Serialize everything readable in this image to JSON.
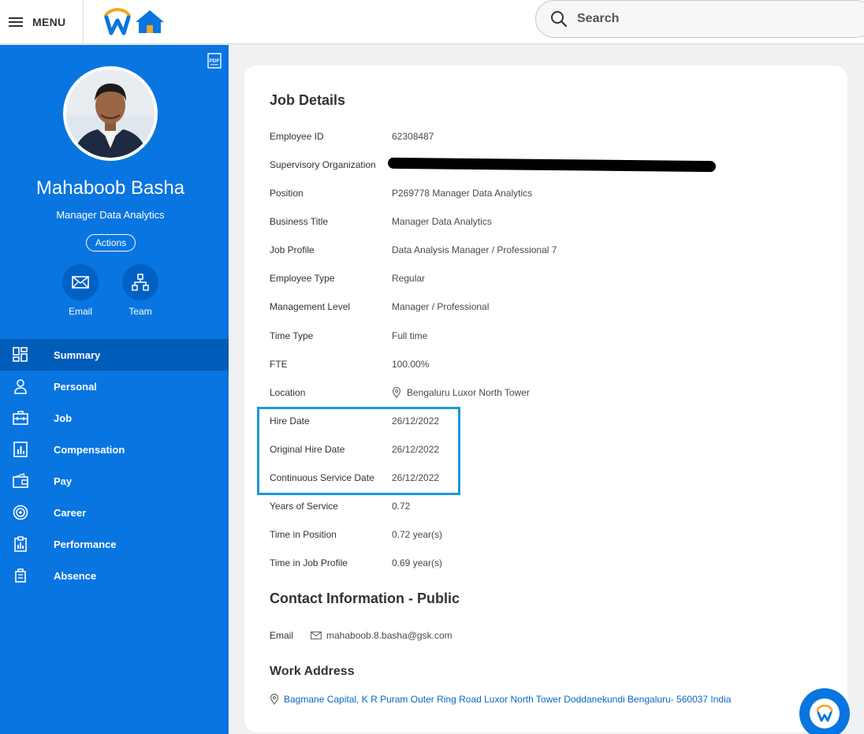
{
  "topbar": {
    "menu_label": "MENU",
    "search_placeholder": "Search"
  },
  "profile": {
    "name": "Mahaboob Basha",
    "title": "Manager Data Analytics",
    "actions_label": "Actions",
    "quick_actions": [
      {
        "label": "Email",
        "icon": "envelope-icon"
      },
      {
        "label": "Team",
        "icon": "org-chart-icon"
      }
    ]
  },
  "nav": [
    {
      "label": "Summary",
      "icon": "dashboard-icon",
      "active": true
    },
    {
      "label": "Personal",
      "icon": "person-icon"
    },
    {
      "label": "Job",
      "icon": "briefcase-icon"
    },
    {
      "label": "Compensation",
      "icon": "bar-chart-icon"
    },
    {
      "label": "Pay",
      "icon": "wallet-icon"
    },
    {
      "label": "Career",
      "icon": "target-icon"
    },
    {
      "label": "Performance",
      "icon": "clipboard-icon"
    },
    {
      "label": "Absence",
      "icon": "luggage-icon"
    }
  ],
  "job_details": {
    "title": "Job Details",
    "rows": [
      {
        "label": "Employee ID",
        "value": "62308487"
      },
      {
        "label": "Supervisory Organization",
        "value": ""
      },
      {
        "label": "Position",
        "value": "P269778 Manager Data Analytics"
      },
      {
        "label": "Business Title",
        "value": "Manager Data Analytics"
      },
      {
        "label": "Job Profile",
        "value": "Data Analysis Manager / Professional 7"
      },
      {
        "label": "Employee Type",
        "value": "Regular"
      },
      {
        "label": "Management Level",
        "value": "Manager / Professional"
      },
      {
        "label": "Time Type",
        "value": "Full time"
      },
      {
        "label": "FTE",
        "value": "100.00%"
      },
      {
        "label": "Location",
        "value": "Bengaluru Luxor North Tower"
      },
      {
        "label": "Hire Date",
        "value": "26/12/2022"
      },
      {
        "label": "Original Hire Date",
        "value": "26/12/2022"
      },
      {
        "label": "Continuous Service Date",
        "value": "26/12/2022"
      },
      {
        "label": "Years of Service",
        "value": "0.72"
      },
      {
        "label": "Time in Position",
        "value": "0.72 year(s)"
      },
      {
        "label": "Time in Job Profile",
        "value": "0.69 year(s)"
      }
    ]
  },
  "contact": {
    "title": "Contact Information - Public",
    "email_label": "Email",
    "email": "mahaboob.8.basha@gsk.com"
  },
  "work_address": {
    "title": "Work Address",
    "address": "Bagmane Capital, K R Puram Outer Ring Road Luxor North Tower Doddanekundi Bengaluru- 560037 India"
  },
  "colors": {
    "brand_blue": "#0875e1",
    "active_nav": "#005cb9",
    "link": "#0b66c3",
    "highlight_border": "#1a9ad9",
    "logo_orange": "#f5a623"
  }
}
